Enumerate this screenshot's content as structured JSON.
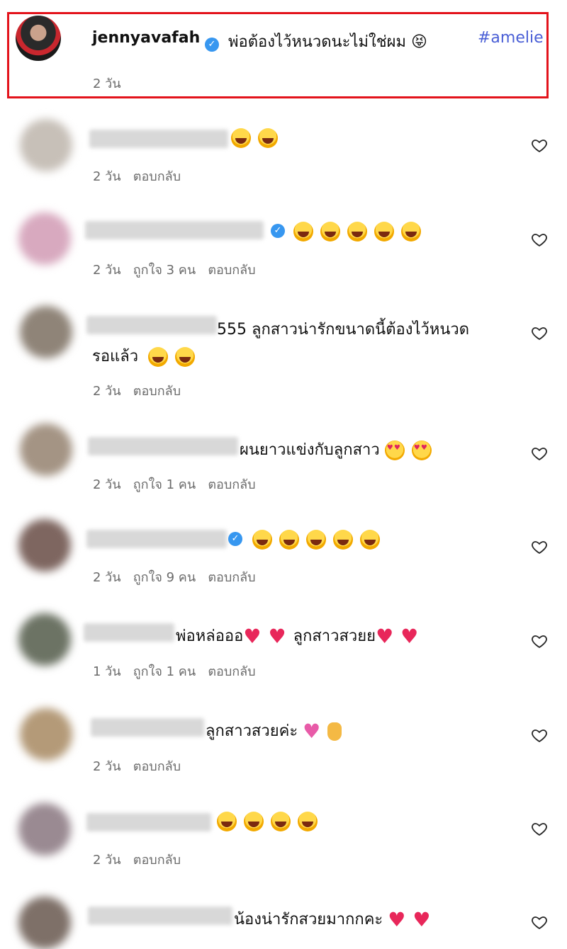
{
  "caption": {
    "username": "jennyavafah",
    "verified_icon": "verified-badge-icon",
    "text": "พ่อต้องไว้หนวดนะไม่ใช่ผม 😝",
    "hashtag": "#amelie",
    "time": "2 วัน",
    "highlight_color": "#e3131b"
  },
  "comments": [
    {
      "text": "😂 🤣",
      "time": "2 วัน",
      "likes": "",
      "reply": "ตอบกลับ"
    },
    {
      "text": "😂😂😂😂😂",
      "time": "2 วัน",
      "likes": "ถูกใจ 3 คน",
      "reply": "ตอบกลับ"
    },
    {
      "text": "555 ลูกสาวน่ารักขนาดนี้ต้องไว้หนวด",
      "text2": "รอแล้ว",
      "time": "2 วัน",
      "likes": "",
      "reply": "ตอบกลับ"
    },
    {
      "text": "ผนยาวแข่งกับลูกสาว",
      "time": "2 วัน",
      "likes": "ถูกใจ 1 คน",
      "reply": "ตอบกลับ"
    },
    {
      "text": "😂😂😂😂😂",
      "time": "2 วัน",
      "likes": "ถูกใจ 9 คน",
      "reply": "ตอบกลับ"
    },
    {
      "text": "พ่อหล่อออ",
      "text2": "ลูกสาวสวยย",
      "time": "1 วัน",
      "likes": "ถูกใจ 1 คน",
      "reply": "ตอบกลับ"
    },
    {
      "text": "ลูกสาวสวยค่ะ",
      "time": "2 วัน",
      "likes": "",
      "reply": "ตอบกลับ"
    },
    {
      "text": "😂😂😂😂",
      "time": "2 วัน",
      "likes": "",
      "reply": "ตอบกลับ"
    },
    {
      "text": "น้องน่ารักสวยมากกคะ",
      "time": "",
      "likes": "",
      "reply": ""
    }
  ],
  "icons": {
    "like": "heart-outline-icon",
    "verified": "verified-badge-icon"
  },
  "colors": {
    "verified": "#3797f0",
    "hashtag": "#4a5fd6",
    "meta_text": "#6b6b6b"
  }
}
